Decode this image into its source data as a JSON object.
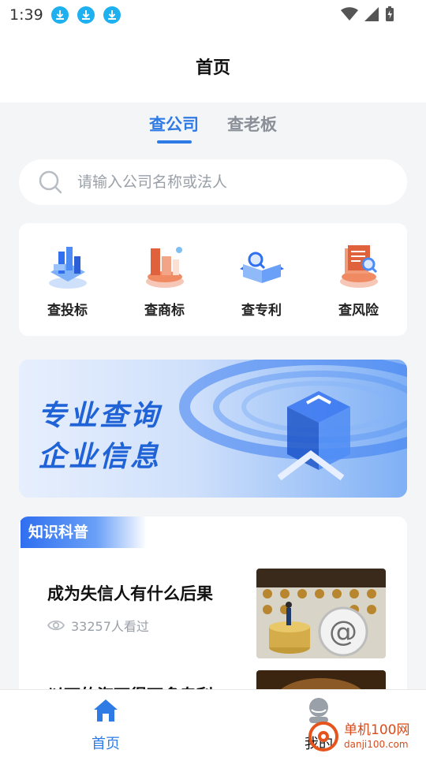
{
  "status": {
    "time": "1:39"
  },
  "header": {
    "title": "首页"
  },
  "tabs": [
    {
      "label": "查公司"
    },
    {
      "label": "查老板"
    }
  ],
  "search": {
    "placeholder": "请输入公司名称或法人"
  },
  "quick_actions": [
    {
      "label": "查投标",
      "icon": "bid-icon"
    },
    {
      "label": "查商标",
      "icon": "trademark-icon"
    },
    {
      "label": "查专利",
      "icon": "patent-icon"
    },
    {
      "label": "查风险",
      "icon": "risk-icon"
    }
  ],
  "banner": {
    "line1": "专业查询",
    "line2": "企业信息"
  },
  "knowledge": {
    "title": "知识科普",
    "articles": [
      {
        "title": "成为失信人有什么后果",
        "views": "33257人看过"
      },
      {
        "title": "以下的海下得下多专利"
      }
    ]
  },
  "bottom_nav": [
    {
      "label": "首页"
    },
    {
      "label": "我的"
    }
  ],
  "watermark": {
    "cn": "单机100网",
    "en": "danji100.com"
  },
  "colors": {
    "accent": "#2f7be5",
    "background": "#f4f5f7"
  }
}
